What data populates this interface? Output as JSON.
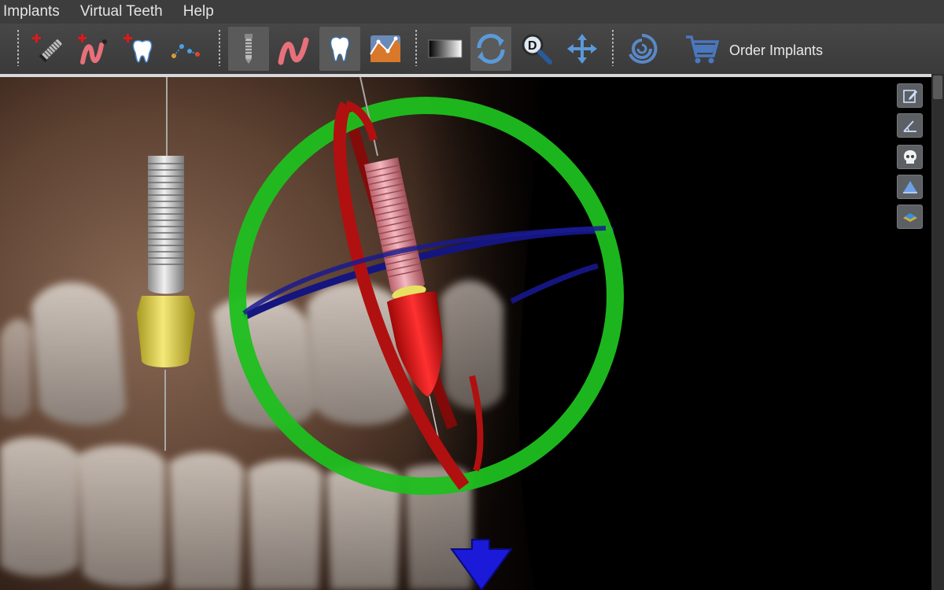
{
  "menu": {
    "items": [
      {
        "label": "Implants"
      },
      {
        "label": "Virtual Teeth"
      },
      {
        "label": "Help"
      }
    ]
  },
  "toolbar": {
    "buttons": [
      {
        "name": "add-implant-icon"
      },
      {
        "name": "add-nerve-icon"
      },
      {
        "name": "add-tooth-icon"
      },
      {
        "name": "add-point-icon"
      },
      {
        "name": "implant-view-icon"
      },
      {
        "name": "nerve-view-icon"
      },
      {
        "name": "tooth-view-icon"
      },
      {
        "name": "bone-density-icon"
      },
      {
        "name": "grayscale-icon"
      },
      {
        "name": "rotate-icon"
      },
      {
        "name": "zoom-icon"
      },
      {
        "name": "pan-icon"
      },
      {
        "name": "reset-view-icon"
      },
      {
        "name": "cart-icon"
      }
    ],
    "order_label": "Order Implants"
  },
  "side_toolbar": {
    "buttons": [
      {
        "name": "edit-note-icon"
      },
      {
        "name": "angle-measure-icon"
      },
      {
        "name": "skull-icon"
      },
      {
        "name": "volume-render-icon"
      },
      {
        "name": "scan-layer-icon"
      }
    ]
  },
  "colors": {
    "menubar": "#3d3d3d",
    "toolbar": "#444444",
    "gizmo_green": "#1fbf1f",
    "gizmo_red": "#b01010",
    "gizmo_blue": "#151580",
    "implant_red": "#e62020",
    "abutment_yellow": "#d8c840"
  }
}
